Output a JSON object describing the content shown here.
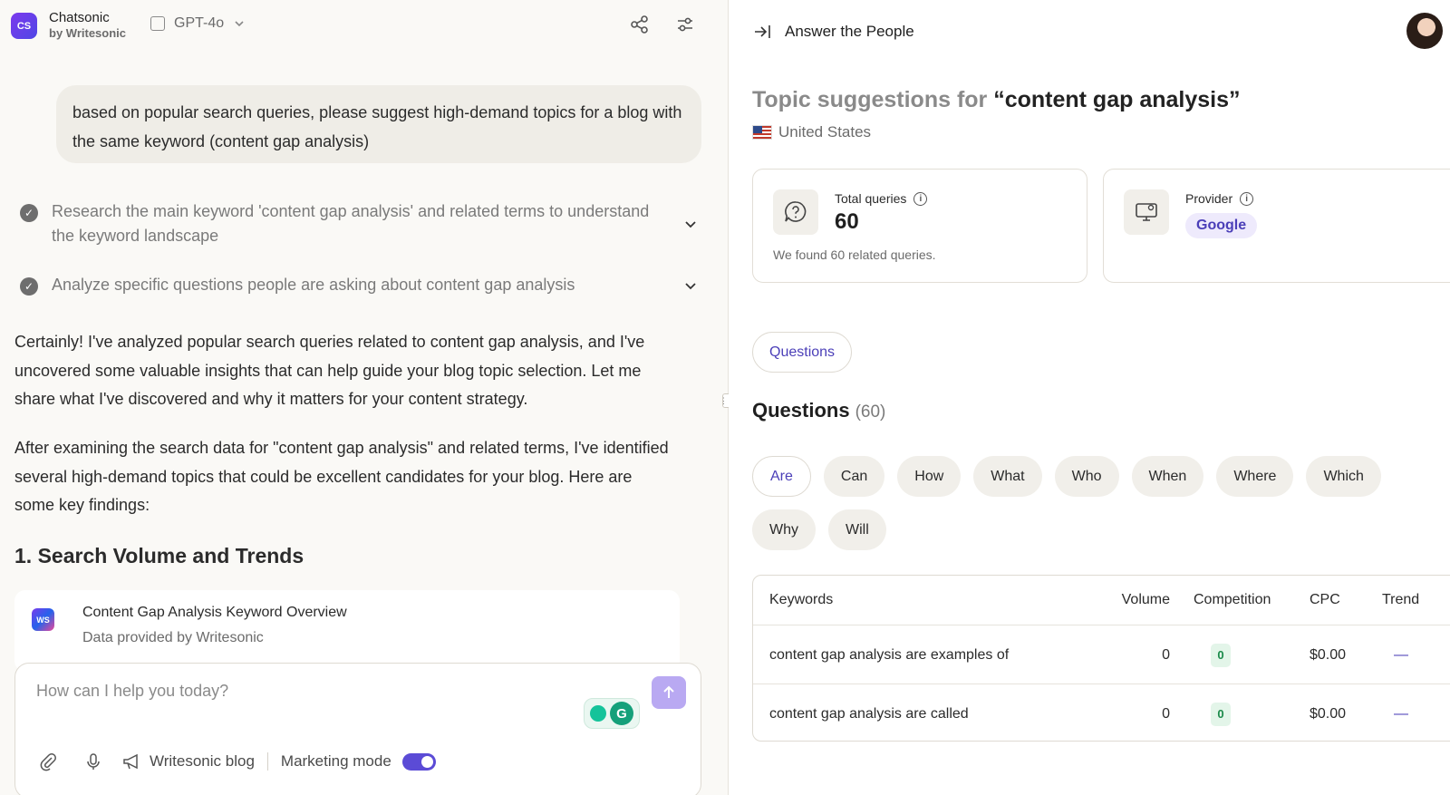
{
  "app": {
    "logo_text": "CS",
    "name": "Chatsonic",
    "byline": "by Writesonic",
    "model": "GPT-4o"
  },
  "chat": {
    "user_message": "based on popular search queries, please suggest high-demand topics for a blog with the same keyword (content gap analysis)",
    "steps": [
      {
        "text": "Research the main keyword 'content gap analysis' and related terms to understand the keyword landscape"
      },
      {
        "text": "Analyze specific questions people are asking about content gap analysis"
      }
    ],
    "paragraphs": [
      "Certainly! I've analyzed popular search queries related to content gap analysis, and I've uncovered some valuable insights that can help guide your blog topic selection. Let me share what I've discovered and why it matters for your content strategy.",
      "After examining the search data for \"content gap analysis\" and related terms, I've identified several high-demand topics that could be excellent candidates for your blog. Here are some key findings:"
    ],
    "section_heading": "1. Search Volume and Trends",
    "tool_card": {
      "logo_text": "WS",
      "title": "Content Gap Analysis Keyword Overview",
      "subtitle": "Data provided by Writesonic"
    },
    "composer": {
      "placeholder": "How can I help you today?",
      "writesonic_blog": "Writesonic blog",
      "marketing_mode": "Marketing mode",
      "marketing_mode_on": true
    }
  },
  "panel": {
    "title": "Answer the People",
    "topic_prefix": "Topic suggestions for",
    "topic_keyword": "“content gap analysis”",
    "country": "United States",
    "total_queries": {
      "label": "Total queries",
      "value": "60",
      "note": "We found 60 related queries."
    },
    "provider": {
      "label": "Provider",
      "value": "Google"
    },
    "tab": "Questions",
    "questions_heading": "Questions",
    "questions_count": "(60)",
    "filters": [
      "Are",
      "Can",
      "How",
      "What",
      "Who",
      "When",
      "Where",
      "Which",
      "Why",
      "Will"
    ],
    "active_filter": "Are",
    "table": {
      "headers": {
        "keywords": "Keywords",
        "volume": "Volume",
        "competition": "Competition",
        "cpc": "CPC",
        "trend": "Trend"
      },
      "rows": [
        {
          "keyword": "content gap analysis are examples of",
          "volume": "0",
          "competition": "0",
          "cpc": "$0.00",
          "trend": "—"
        },
        {
          "keyword": "content gap analysis are called",
          "volume": "0",
          "competition": "0",
          "cpc": "$0.00",
          "trend": "—"
        }
      ]
    }
  },
  "colors": {
    "accent": "#5b4bd6",
    "accent_text": "#4b3fb8",
    "left_bg": "#faf9f6",
    "bubble_bg": "#efede7"
  }
}
